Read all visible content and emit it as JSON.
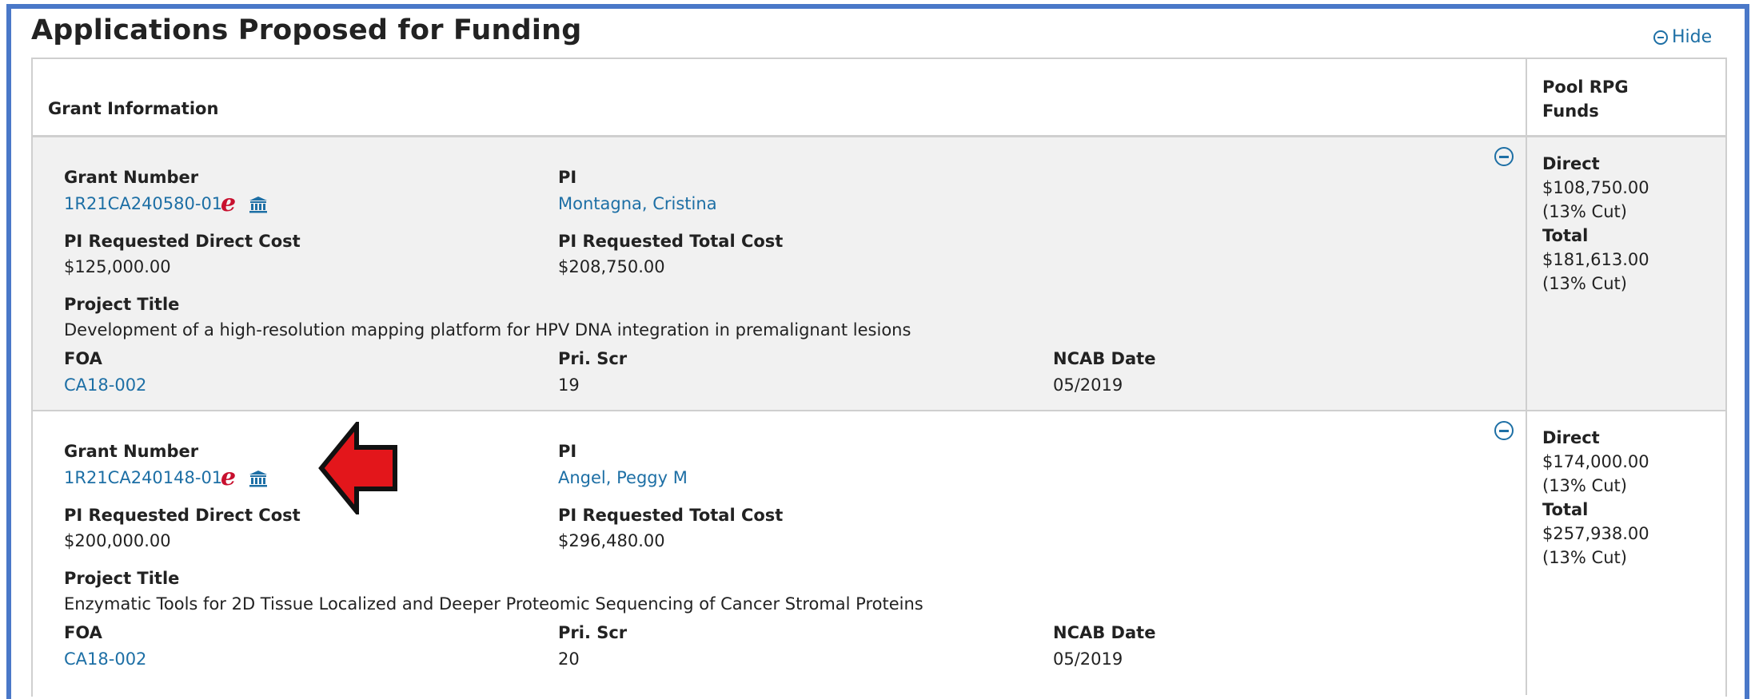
{
  "panel": {
    "title": "Applications Proposed for Funding",
    "hide_label": "Hide"
  },
  "table": {
    "header_grant": "Grant Information",
    "header_pool": "Pool RPG Funds"
  },
  "labels": {
    "grant_number": "Grant Number",
    "pi": "PI",
    "direct_cost": "PI Requested Direct Cost",
    "total_cost": "PI Requested Total Cost",
    "project_title": "Project Title",
    "foa": "FOA",
    "pri_scr": "Pri. Scr",
    "ncab_date": "NCAB Date",
    "direct": "Direct",
    "total": "Total",
    "ecommons_icon_glyph": "e"
  },
  "rows": [
    {
      "grant_number": "1R21CA240580-01",
      "pi": "Montagna, Cristina",
      "direct_cost": "$125,000.00",
      "total_cost": "$208,750.00",
      "project_title": "Development of a high-resolution mapping platform for HPV DNA integration in premalignant lesions",
      "foa": "CA18-002",
      "pri_scr": "19",
      "ncab_date": "05/2019",
      "pool_direct": "$108,750.00",
      "pool_direct_cut": "(13% Cut)",
      "pool_total": "$181,613.00",
      "pool_total_cut": "(13% Cut)"
    },
    {
      "grant_number": "1R21CA240148-01",
      "pi": "Angel, Peggy M",
      "direct_cost": "$200,000.00",
      "total_cost": "$296,480.00",
      "project_title": "Enzymatic Tools for 2D Tissue Localized and Deeper Proteomic Sequencing of Cancer Stromal Proteins",
      "foa": "CA18-002",
      "pri_scr": "20",
      "ncab_date": "05/2019",
      "pool_direct": "$174,000.00",
      "pool_direct_cut": "(13% Cut)",
      "pool_total": "$257,938.00",
      "pool_total_cut": "(13% Cut)"
    }
  ],
  "colors": {
    "frame_border": "#4a78c8",
    "link": "#1d6fa5",
    "ecommons_red": "#c8102e",
    "row_shade": "#f1f1f1",
    "annotation_arrow": "#e3161b"
  },
  "icons": [
    "circle-minus-icon",
    "ecommons-icon",
    "institution-icon",
    "red-arrow-annotation"
  ]
}
